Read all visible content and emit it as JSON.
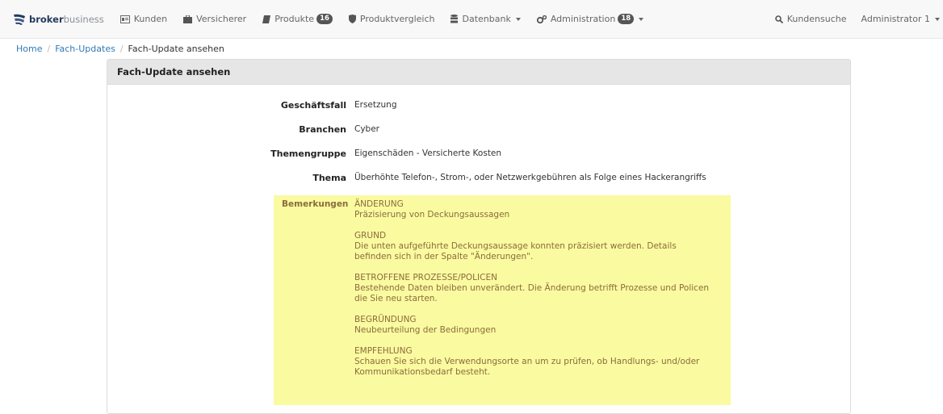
{
  "navbar": {
    "brand_bold": "broker",
    "brand_light": "business",
    "items": [
      {
        "label": "Kunden",
        "icon": "id-card-icon"
      },
      {
        "label": "Versicherer",
        "icon": "briefcase-icon"
      },
      {
        "label": "Produkte",
        "icon": "book-icon",
        "badge": "16"
      },
      {
        "label": "Produktvergleich",
        "icon": "shield-icon"
      },
      {
        "label": "Datenbank",
        "icon": "database-icon",
        "dropdown": true
      },
      {
        "label": "Administration",
        "icon": "gears-icon",
        "badge": "18",
        "dropdown": true
      }
    ],
    "search_label": "Kundensuche",
    "user_label": "Administrator 1"
  },
  "breadcrumb": {
    "home": "Home",
    "section": "Fach-Updates",
    "current": "Fach-Update ansehen"
  },
  "panel": {
    "title": "Fach-Update ansehen",
    "fields": [
      {
        "label": "Geschäftsfall",
        "value": "Ersetzung"
      },
      {
        "label": "Branchen",
        "value": "Cyber"
      },
      {
        "label": "Themengruppe",
        "value": "Eigenschäden - Versicherte Kosten"
      },
      {
        "label": "Thema",
        "value": "Überhöhte Telefon-, Strom-, oder Netzwerkgebühren als Folge eines Hackerangriffs"
      }
    ],
    "remarks_label": "Bemerkungen",
    "remarks": [
      [
        "ÄNDERUNG",
        "Präzisierung von Deckungsaussagen"
      ],
      [
        "GRUND",
        "Die unten aufgeführte Deckungsaussage konnten präzisiert werden. Details",
        "befinden sich in der Spalte \"Änderungen\"."
      ],
      [
        "BETROFFENE PROZESSE/POLICEN",
        "Bestehende Daten bleiben unverändert. Die Änderung betrifft Prozesse und Policen",
        "die Sie neu starten."
      ],
      [
        "BEGRÜNDUNG",
        "Neubeurteilung der Bedingungen"
      ],
      [
        "EMPFEHLUNG",
        "Schauen Sie sich die Verwendungsorte an um zu prüfen, ob Handlungs- und/oder",
        "Kommunikationsbedarf besteht."
      ]
    ]
  },
  "colors": {
    "accent": "#2f7ab8",
    "highlight": "#fafaa0",
    "remark_text": "#8a6d3b",
    "brand": "#243a5e"
  }
}
